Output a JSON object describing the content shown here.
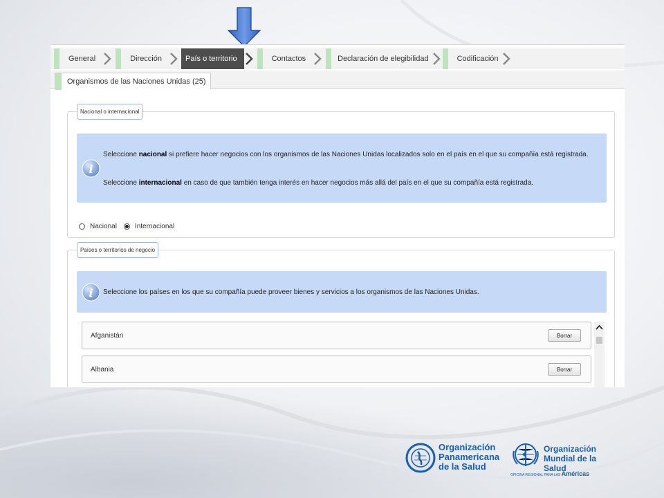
{
  "wizard_steps": [
    {
      "label": "General",
      "active": false
    },
    {
      "label": "Dirección",
      "active": false
    },
    {
      "label": "País o territorio",
      "active": true
    },
    {
      "label": "Contactos",
      "active": false
    },
    {
      "label": "Declaración de elegibilidad",
      "active": false
    },
    {
      "label": "Codificación",
      "active": false
    }
  ],
  "subtab": {
    "label": "Organismos de las Naciones Unidas (25)"
  },
  "section_national": {
    "legend": "Nacional o internacional",
    "info_line1_pre": "Seleccione ",
    "info_line1_bold": "nacional",
    "info_line1_post": " si prefiere hacer negocios con los organismos de las Naciones Unidas localizados solo en el país en el que su compañía está registrada.",
    "info_line2_pre": "Seleccione ",
    "info_line2_bold": "internacional",
    "info_line2_post": " en caso de que también tenga interés en hacer negocios más allá del país en el que su compañía está registrada.",
    "radio_national": "Nacional",
    "radio_international": "Internacional",
    "selected": "Internacional"
  },
  "section_countries": {
    "legend": "Países o territorios de negocio",
    "info_text": "Seleccione los países en los que su compañía puede proveer bienes y servicios a los organismos de las Naciones Unidas.",
    "countries": [
      {
        "name": "Afganistán",
        "button": "Borrar"
      },
      {
        "name": "Albania",
        "button": "Borrar"
      }
    ]
  },
  "logos": {
    "ops_line1": "Organización",
    "ops_line2": "Panamericana",
    "ops_line3": "de la Salud",
    "oms_line1": "Organización",
    "oms_line2": "Mundial de la Salud",
    "oms_sub_small": "OFICINA REGIONAL PARA LAS",
    "oms_sub_big": "Américas"
  },
  "colors": {
    "step_green": "#bfe3bf",
    "active_step": "#4d4d4d",
    "info_bg": "#c6d9f7",
    "arrow_blue": "#3a6fd0",
    "logo_blue": "#1a5ea8"
  }
}
